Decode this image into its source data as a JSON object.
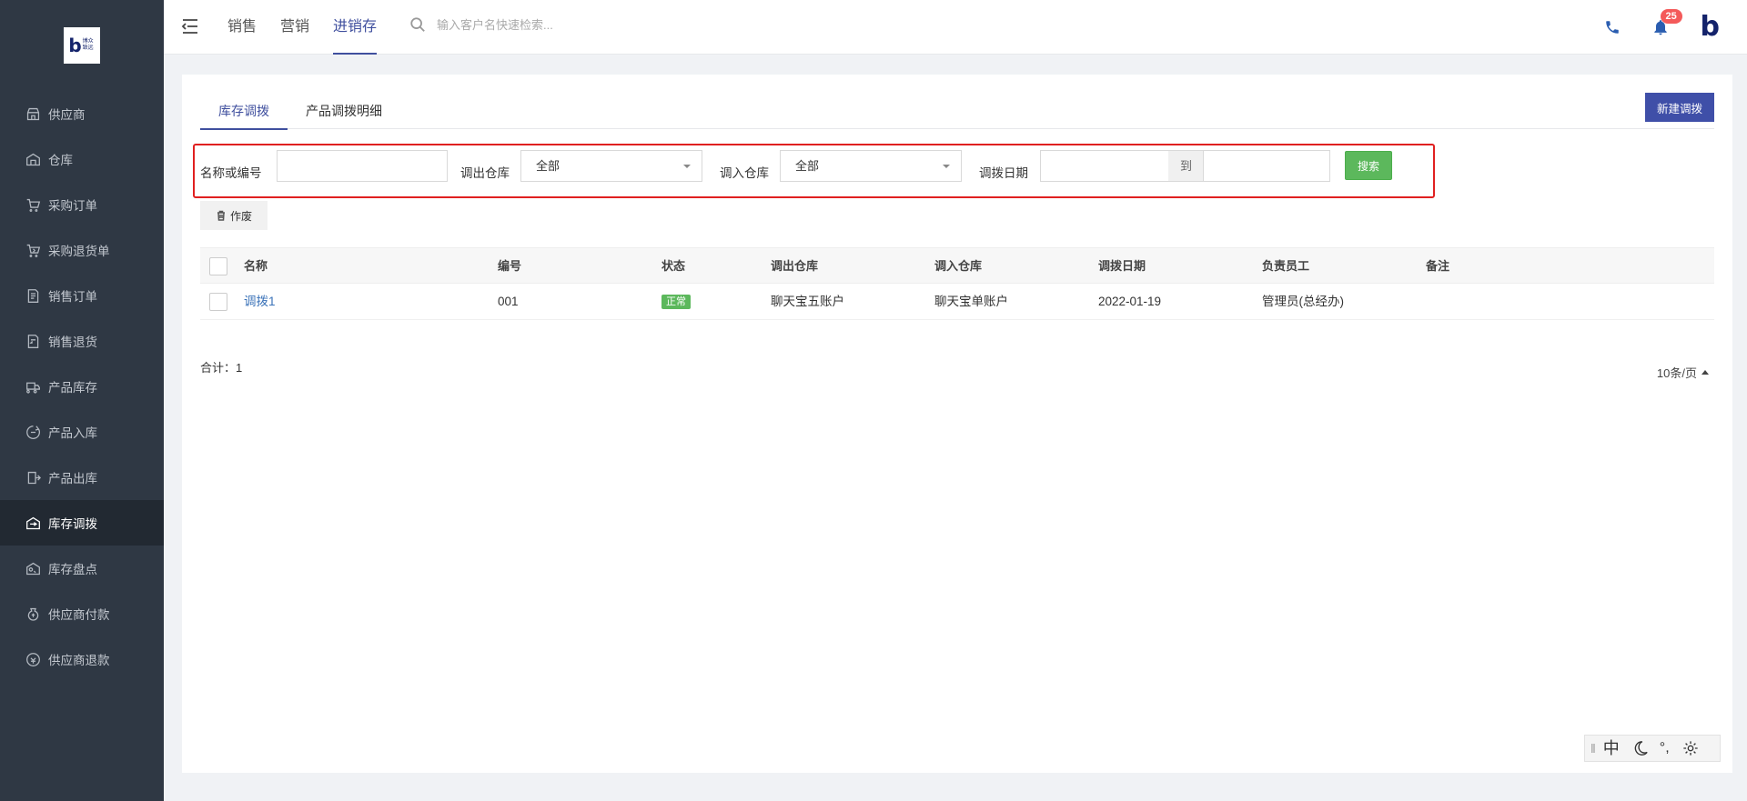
{
  "app": {
    "logo_text": "博众致远"
  },
  "sidebar": {
    "items": [
      {
        "label": "供应商",
        "icon": "store-icon"
      },
      {
        "label": "仓库",
        "icon": "warehouse-icon"
      },
      {
        "label": "采购订单",
        "icon": "cart-icon"
      },
      {
        "label": "采购退货单",
        "icon": "cart-return-icon"
      },
      {
        "label": "销售订单",
        "icon": "document-icon"
      },
      {
        "label": "销售退货",
        "icon": "return-document-icon"
      },
      {
        "label": "产品库存",
        "icon": "truck-icon"
      },
      {
        "label": "产品入库",
        "icon": "inbound-icon"
      },
      {
        "label": "产品出库",
        "icon": "outbound-icon"
      },
      {
        "label": "库存调拨",
        "icon": "transfer-icon",
        "active": true
      },
      {
        "label": "库存盘点",
        "icon": "stocktake-icon"
      },
      {
        "label": "供应商付款",
        "icon": "money-bag-icon"
      },
      {
        "label": "供应商退款",
        "icon": "refund-icon"
      }
    ]
  },
  "header": {
    "tabs": [
      "销售",
      "营销",
      "进销存"
    ],
    "active_tab": "进销存",
    "search_placeholder": "输入客户名快速检索...",
    "notification_count": "25"
  },
  "main": {
    "tabs": [
      "库存调拨",
      "产品调拨明细"
    ],
    "active_tab": "库存调拨",
    "new_button": "新建调拨",
    "filters": {
      "name_label": "名称或编号",
      "name_value": "",
      "out_label": "调出仓库",
      "out_value": "全部",
      "in_label": "调入仓库",
      "in_value": "全部",
      "date_label": "调拨日期",
      "date_sep": "到",
      "search_button": "搜索"
    },
    "void_button": "作废",
    "table": {
      "columns": [
        "名称",
        "编号",
        "状态",
        "调出仓库",
        "调入仓库",
        "调拨日期",
        "负责员工",
        "备注"
      ],
      "rows": [
        {
          "name": "调拨1",
          "code": "001",
          "status": "正常",
          "out": "聊天宝五账户",
          "in": "聊天宝单账户",
          "date": "2022-01-19",
          "owner": "管理员(总经办)",
          "remark": ""
        }
      ]
    },
    "total": "合计：1",
    "page_size": "10条/页"
  },
  "ime": {
    "lang": "中",
    "punct": "°,"
  },
  "colors": {
    "accent": "#3f4fa8",
    "sidebar_bg": "#2f3844",
    "success": "#5cb85c",
    "highlight_border": "#e02020"
  }
}
